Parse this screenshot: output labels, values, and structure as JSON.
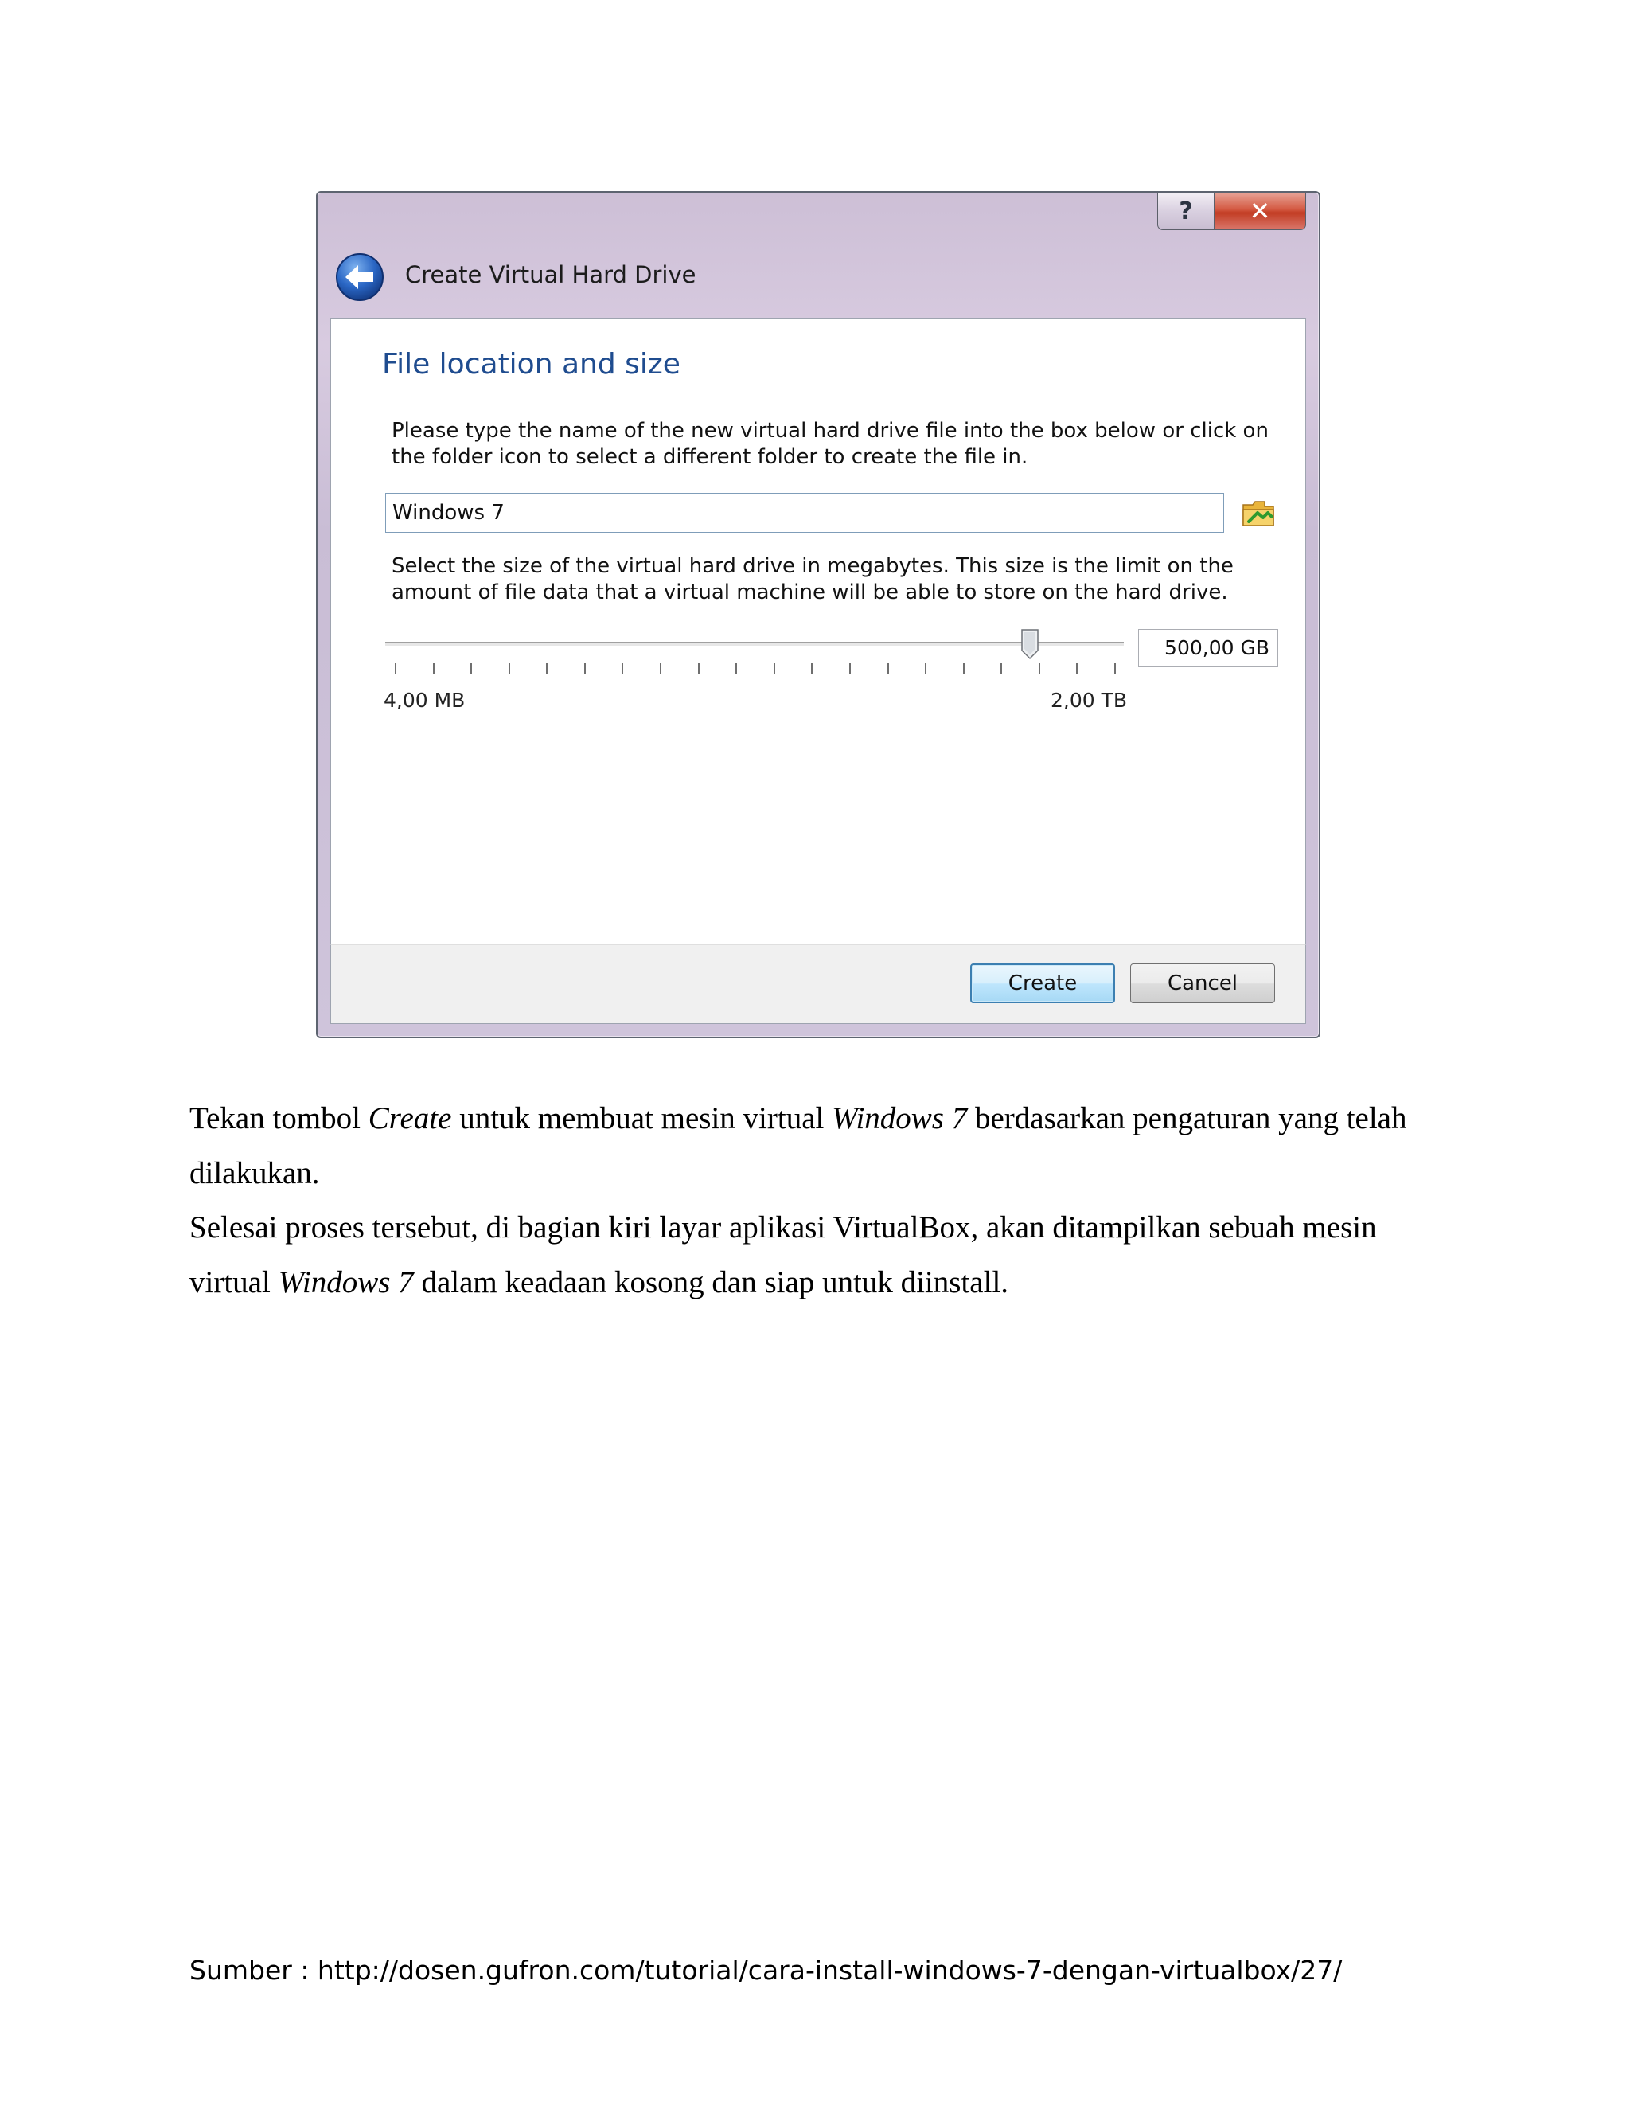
{
  "dialog": {
    "title": "Create Virtual Hard Drive",
    "help_label": "?",
    "close_label": "✕",
    "heading": "File location and size",
    "location_description": "Please type the name of the new virtual hard drive file into the box below or click on the folder icon to select a different folder to create the file in.",
    "file_name_value": "Windows 7",
    "size_description": "Select the size of the virtual hard drive in megabytes. This size is the limit on the amount of file data that a virtual machine will be able to store on the hard drive.",
    "size_value": "500,00 GB",
    "slider_position_fraction": 0.873,
    "slider_tick_count": 20,
    "range_min_label": "4,00 MB",
    "range_max_label": "2,00 TB",
    "create_label": "Create",
    "cancel_label": "Cancel",
    "colors": {
      "heading": "#1f4c8f",
      "accent_button_border": "#3c7fb1",
      "close_button": "#c23d24"
    }
  },
  "body_text": {
    "p1_a": "Tekan tombol ",
    "p1_b": "Create",
    "p1_c": " untuk membuat mesin virtual ",
    "p1_d": "Windows 7",
    "p1_e": " berdasarkan pengaturan yang telah dilakukan.",
    "p2_a": "Selesai proses tersebut, di bagian kiri layar aplikasi VirtualBox, akan ditampilkan sebuah mesin virtual ",
    "p2_b": "Windows 7",
    "p2_c": " dalam keadaan kosong dan siap untuk diinstall."
  },
  "source": "Sumber : http://dosen.gufron.com/tutorial/cara-install-windows-7-dengan-virtualbox/27/"
}
